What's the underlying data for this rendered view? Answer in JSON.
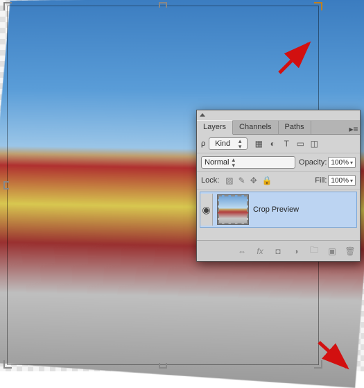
{
  "panel": {
    "tabs": [
      {
        "label": "Layers",
        "active": true
      },
      {
        "label": "Channels",
        "active": false
      },
      {
        "label": "Paths",
        "active": false
      }
    ],
    "filter": {
      "kind_label": "Kind",
      "icons": [
        "image-filter",
        "fx-filter",
        "type-filter",
        "shape-filter",
        "smart-filter"
      ]
    },
    "blend_mode": "Normal",
    "opacity_label": "Opacity:",
    "opacity_value": "100%",
    "lock_label": "Lock:",
    "fill_label": "Fill:",
    "fill_value": "100%",
    "layer": {
      "name": "Crop Preview",
      "visible": true
    },
    "footer_icons": [
      "link",
      "fx",
      "mask",
      "adjust",
      "group",
      "new",
      "trash"
    ]
  },
  "annotation": {
    "arrow_color": "#d21010"
  }
}
